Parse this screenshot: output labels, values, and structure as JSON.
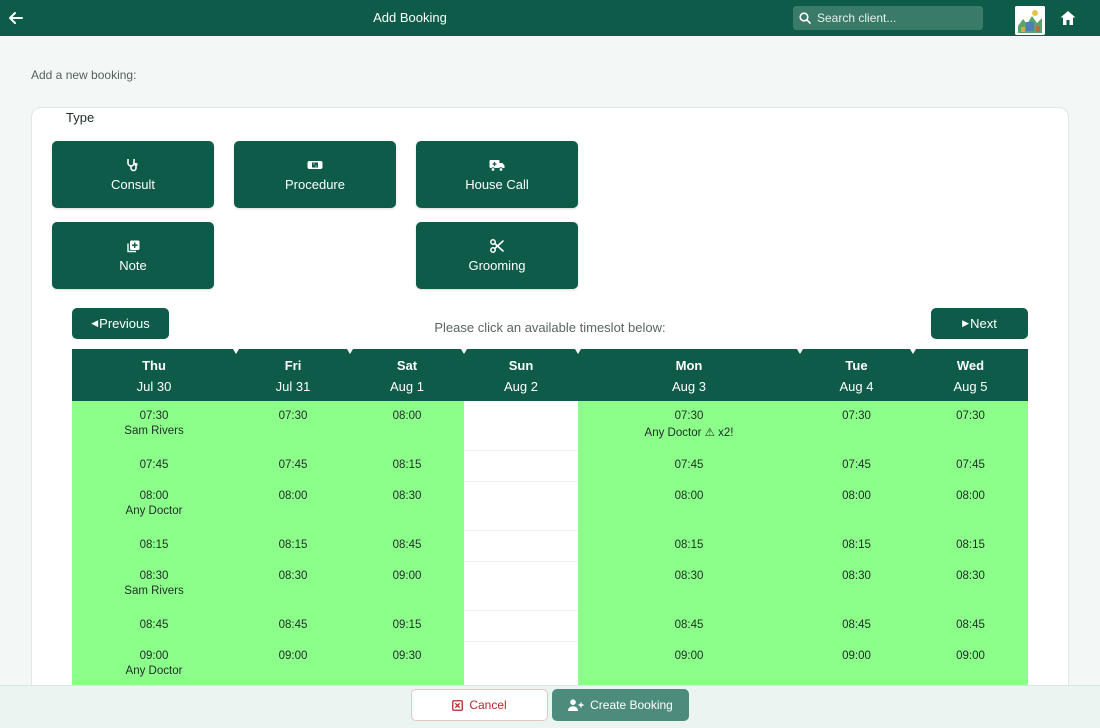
{
  "header": {
    "title": "Add Booking",
    "back_icon": "arrow-left-icon",
    "search_placeholder": "Search client...",
    "home_icon": "home-icon"
  },
  "intro": "Add a new booking:",
  "type_section": {
    "label": "Type",
    "options": [
      {
        "label": "Consult",
        "icon": "stethoscope-icon"
      },
      {
        "label": "Procedure",
        "icon": "bandage-icon"
      },
      {
        "label": "House Call",
        "icon": "truck-medical-icon"
      },
      {
        "label": "Note",
        "icon": "note-plus-icon"
      },
      {
        "label": "Grooming",
        "icon": "scissors-icon"
      }
    ]
  },
  "calendar": {
    "previous_label": "Previous",
    "next_label": "Next",
    "hint": "Please click an available timeslot below:",
    "days": [
      {
        "name": "Thu",
        "date": "Jul 30",
        "available": true,
        "slots": [
          {
            "time": "07:30",
            "doctor": "Sam Rivers"
          },
          {
            "time": "07:45",
            "doctor": ""
          },
          {
            "time": "08:00",
            "doctor": "Any Doctor"
          },
          {
            "time": "08:15",
            "doctor": ""
          },
          {
            "time": "08:30",
            "doctor": "Sam Rivers"
          },
          {
            "time": "08:45",
            "doctor": ""
          },
          {
            "time": "09:00",
            "doctor": "Any Doctor"
          }
        ]
      },
      {
        "name": "Fri",
        "date": "Jul 31",
        "available": true,
        "slots": [
          {
            "time": "07:30",
            "doctor": ""
          },
          {
            "time": "07:45",
            "doctor": ""
          },
          {
            "time": "08:00",
            "doctor": ""
          },
          {
            "time": "08:15",
            "doctor": ""
          },
          {
            "time": "08:30",
            "doctor": ""
          },
          {
            "time": "08:45",
            "doctor": ""
          },
          {
            "time": "09:00",
            "doctor": ""
          }
        ]
      },
      {
        "name": "Sat",
        "date": "Aug 1",
        "available": true,
        "slots": [
          {
            "time": "08:00",
            "doctor": ""
          },
          {
            "time": "08:15",
            "doctor": ""
          },
          {
            "time": "08:30",
            "doctor": ""
          },
          {
            "time": "08:45",
            "doctor": ""
          },
          {
            "time": "09:00",
            "doctor": ""
          },
          {
            "time": "09:15",
            "doctor": ""
          },
          {
            "time": "09:30",
            "doctor": ""
          }
        ]
      },
      {
        "name": "Sun",
        "date": "Aug 2",
        "available": false,
        "slots": []
      },
      {
        "name": "Mon",
        "date": "Aug 3",
        "available": true,
        "slots": [
          {
            "time": "07:30",
            "doctor": "Any Doctor ⚠ x2!"
          },
          {
            "time": "07:45",
            "doctor": ""
          },
          {
            "time": "08:00",
            "doctor": ""
          },
          {
            "time": "08:15",
            "doctor": ""
          },
          {
            "time": "08:30",
            "doctor": ""
          },
          {
            "time": "08:45",
            "doctor": ""
          },
          {
            "time": "09:00",
            "doctor": ""
          }
        ]
      },
      {
        "name": "Tue",
        "date": "Aug 4",
        "available": true,
        "slots": [
          {
            "time": "07:30",
            "doctor": ""
          },
          {
            "time": "07:45",
            "doctor": ""
          },
          {
            "time": "08:00",
            "doctor": ""
          },
          {
            "time": "08:15",
            "doctor": ""
          },
          {
            "time": "08:30",
            "doctor": ""
          },
          {
            "time": "08:45",
            "doctor": ""
          },
          {
            "time": "09:00",
            "doctor": ""
          }
        ]
      },
      {
        "name": "Wed",
        "date": "Aug 5",
        "available": true,
        "slots": [
          {
            "time": "07:30",
            "doctor": ""
          },
          {
            "time": "07:45",
            "doctor": ""
          },
          {
            "time": "08:00",
            "doctor": ""
          },
          {
            "time": "08:15",
            "doctor": ""
          },
          {
            "time": "08:30",
            "doctor": ""
          },
          {
            "time": "08:45",
            "doctor": ""
          },
          {
            "time": "09:00",
            "doctor": ""
          }
        ]
      }
    ]
  },
  "footer": {
    "cancel_label": "Cancel",
    "create_label": "Create Booking"
  },
  "colors": {
    "primary": "#0d5b48",
    "available_slot": "#8cff8a",
    "cancel_text": "#b32a2a",
    "create_button": "#4d8b7d"
  }
}
